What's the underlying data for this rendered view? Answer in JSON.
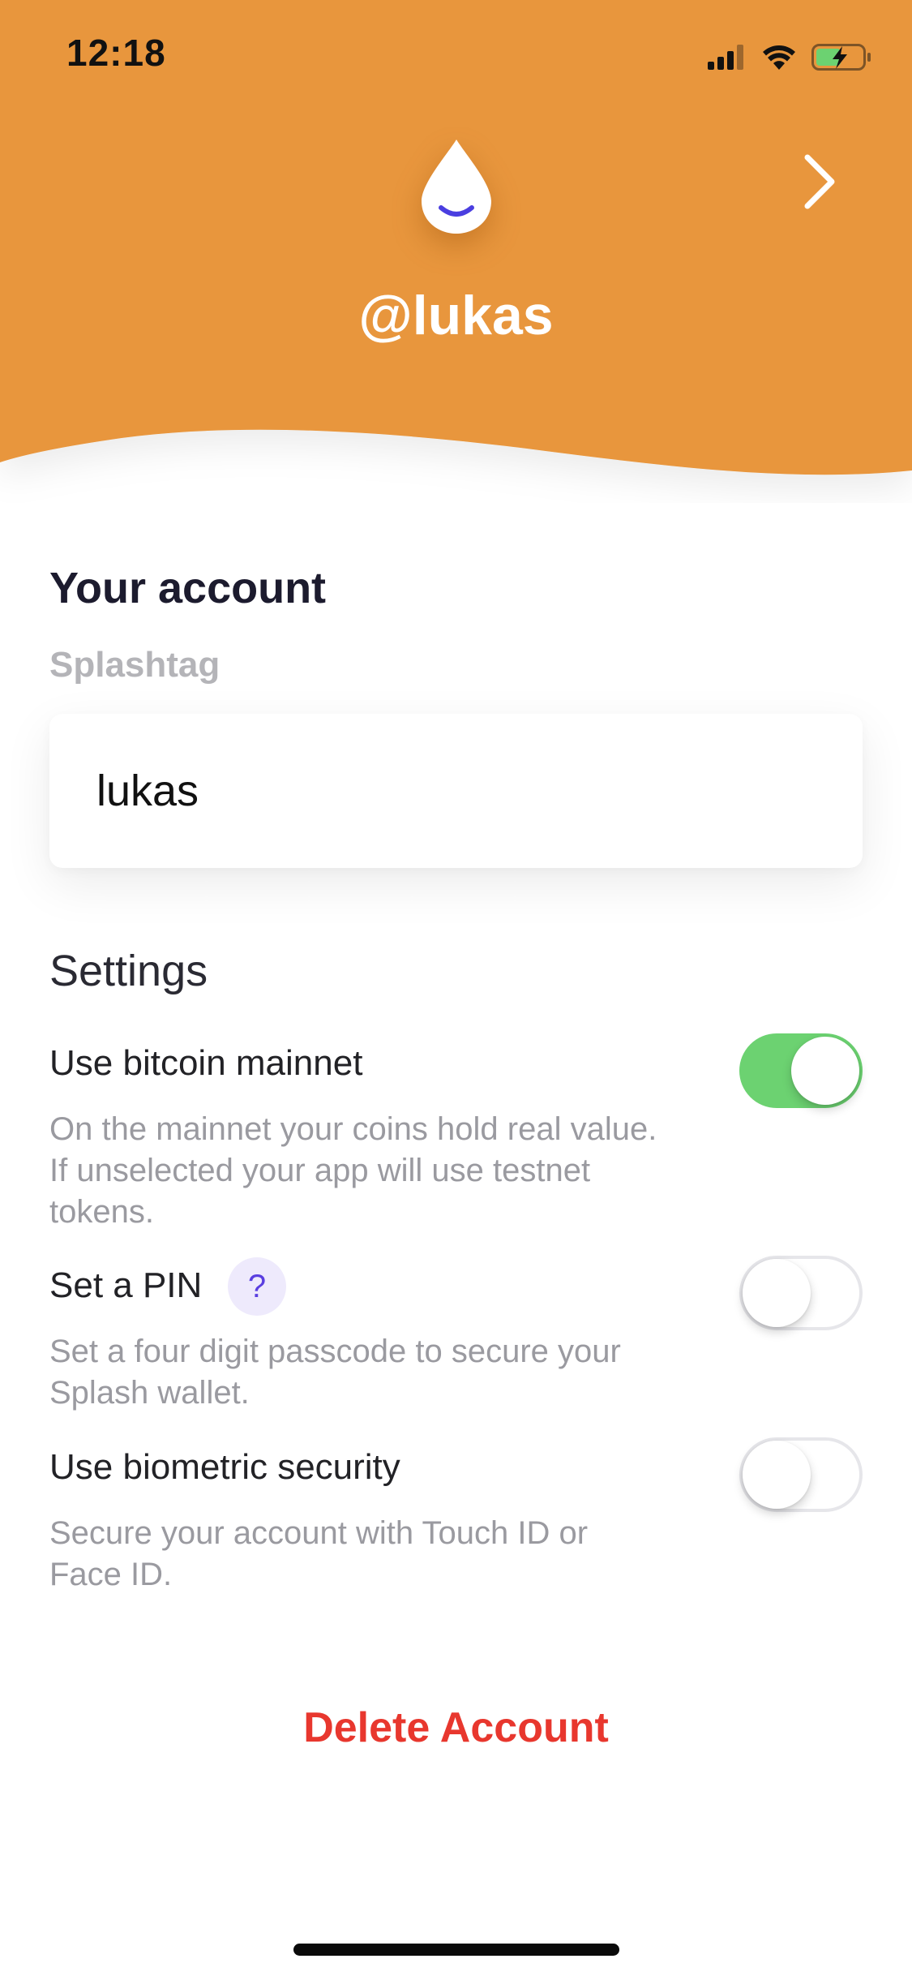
{
  "status_bar": {
    "time": "12:18",
    "icons": [
      "cellular-signal-icon",
      "wifi-icon",
      "battery-charging-icon"
    ]
  },
  "header": {
    "background_color": "#E8963C",
    "logo": "water-drop-smile-icon",
    "nav_icon": "chevron-right-icon",
    "handle": "@lukas"
  },
  "account": {
    "title": "Your account",
    "splashtag_label": "Splashtag",
    "splashtag_value": "lukas"
  },
  "settings": {
    "title": "Settings",
    "items": [
      {
        "label": "Use bitcoin mainnet",
        "description": "On the mainnet your coins hold real value. If unselected your app will use testnet tokens.",
        "enabled": true
      },
      {
        "label": "Set a PIN",
        "help": "?",
        "description": "Set a four digit passcode to secure your Splash wallet.",
        "enabled": false
      },
      {
        "label": "Use biometric security",
        "description": "Secure your account with Touch ID or Face ID.",
        "enabled": false
      }
    ]
  },
  "actions": {
    "delete_label": "Delete Account",
    "delete_color": "#E8372E"
  },
  "colors": {
    "accent": "#E8963C",
    "toggle_on": "#6CD271",
    "help_badge": "#5A3FE0"
  }
}
